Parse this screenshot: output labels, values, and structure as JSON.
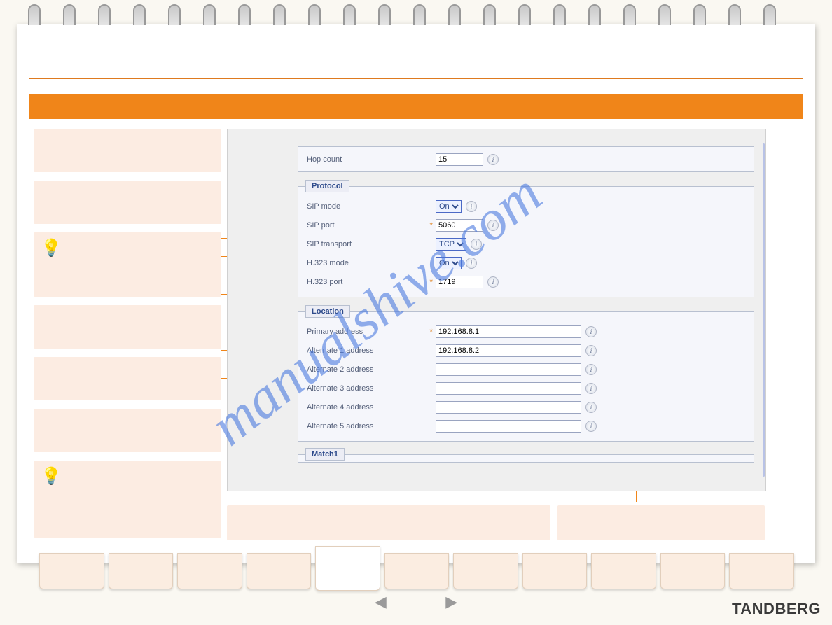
{
  "brand": "TANDBERG",
  "watermark": "manualshive.com",
  "hop": {
    "label": "Hop count",
    "value": "15"
  },
  "protocol": {
    "legend": "Protocol",
    "sip_mode": {
      "label": "SIP mode",
      "value": "On"
    },
    "sip_port": {
      "label": "SIP port",
      "value": "5060",
      "required": true
    },
    "sip_transport": {
      "label": "SIP transport",
      "value": "TCP"
    },
    "h323_mode": {
      "label": "H.323 mode",
      "value": "On"
    },
    "h323_port": {
      "label": "H.323 port",
      "value": "1719",
      "required": true
    }
  },
  "location": {
    "legend": "Location",
    "primary": {
      "label": "Primary address",
      "value": "192.168.8.1",
      "required": true
    },
    "alt1": {
      "label": "Alternate 1 address",
      "value": "192.168.8.2"
    },
    "alt2": {
      "label": "Alternate 2 address",
      "value": ""
    },
    "alt3": {
      "label": "Alternate 3 address",
      "value": ""
    },
    "alt4": {
      "label": "Alternate 4 address",
      "value": ""
    },
    "alt5": {
      "label": "Alternate 5 address",
      "value": ""
    }
  },
  "match_legend": "Match1",
  "options": {
    "on": "On",
    "tcp": "TCP"
  }
}
